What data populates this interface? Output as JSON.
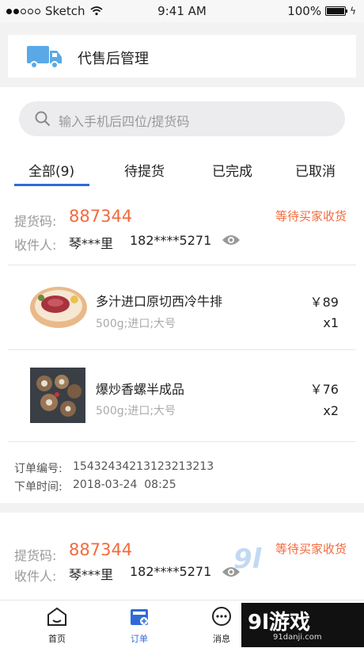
{
  "status_bar": {
    "carrier": "Sketch",
    "time": "9:41 AM",
    "battery": "100%"
  },
  "header": {
    "title": "代售后管理",
    "icon": "truck-icon"
  },
  "search": {
    "placeholder": "输入手机后四位/提货码"
  },
  "tabs": [
    {
      "label": "全部(9)",
      "active": true
    },
    {
      "label": "待提货"
    },
    {
      "label": "已完成"
    },
    {
      "label": "已取消"
    }
  ],
  "orders": [
    {
      "code_label": "提货码:",
      "code": "887344",
      "status": "等待买家收货",
      "receiver_label": "收件人:",
      "receiver_name": "琴***里",
      "receiver_phone": "182****5271",
      "items": [
        {
          "name": "多汁进口原切西冷牛排",
          "spec": "500g;进口;大号",
          "price": "￥89",
          "qty": "x1"
        },
        {
          "name": "爆炒香螺半成品",
          "spec": "500g;进口;大号",
          "price": "￥76",
          "qty": "x2"
        }
      ],
      "order_no_label": "订单编号:",
      "order_no": "15432434213123213213",
      "order_time_label": "下单时间:",
      "order_time": "2018-03-24  08:25"
    },
    {
      "code_label": "提货码:",
      "code": "887344",
      "status": "等待买家收货",
      "receiver_label": "收件人:",
      "receiver_name": "琴***里",
      "receiver_phone": "182****5271"
    }
  ],
  "bottom_nav": [
    {
      "label": "首页",
      "icon": "home-icon"
    },
    {
      "label": "订单",
      "icon": "order-icon",
      "active": true
    },
    {
      "label": "消息",
      "icon": "message-icon"
    }
  ],
  "watermark": {
    "logo": "9l游戏",
    "url": "91danji.com"
  },
  "colors": {
    "accent": "#2f6bd8",
    "orange": "#f36a3c",
    "truck": "#5aa9e6"
  }
}
